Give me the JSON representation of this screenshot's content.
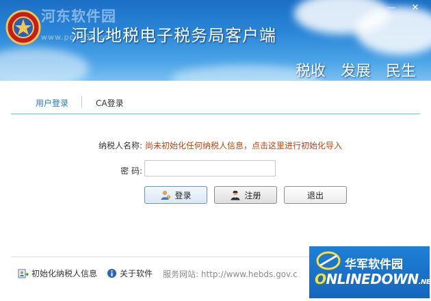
{
  "window": {
    "title": "河北地税电子税务局客户端",
    "minimize_glyph": "—",
    "close_glyph": "✕",
    "slogans": [
      "税收",
      "发展",
      "民生"
    ],
    "watermark_site_cn": "河东软件园",
    "watermark_site_url": "www.pc0359.cn"
  },
  "tabs": [
    {
      "label": "用户登录",
      "active": true
    },
    {
      "label": "CA登录",
      "active": false
    }
  ],
  "form": {
    "name_label": "纳税人名称:",
    "name_value": "尚未初始化任何纳税人信息，点击这里进行初始化导入",
    "password_label": "密 码:",
    "password_value": "",
    "buttons": {
      "login": "登录",
      "register": "注册",
      "exit": "退出"
    }
  },
  "footer": {
    "init_label": "初始化纳税人信息",
    "about_label": "关于软件",
    "site_prefix": "服务网站:",
    "site_url": "http://www.hebds.gov.c"
  },
  "watermark": {
    "cn": "华军软件园",
    "en": "NLINEDOWN",
    "en_prefix": "O",
    "en_suffix": ".NET"
  },
  "colors": {
    "banner_top": "#1b6fc4",
    "banner_bottom": "#79c0f0",
    "tab_active": "#2a7ab8",
    "tab_underline": "#7fb8d8",
    "init_link": "#c0400b"
  },
  "icons": {
    "emblem": "tax-emblem-icon",
    "login": "user-key-icon",
    "register": "user-add-icon",
    "init": "import-user-icon",
    "about": "info-icon"
  }
}
